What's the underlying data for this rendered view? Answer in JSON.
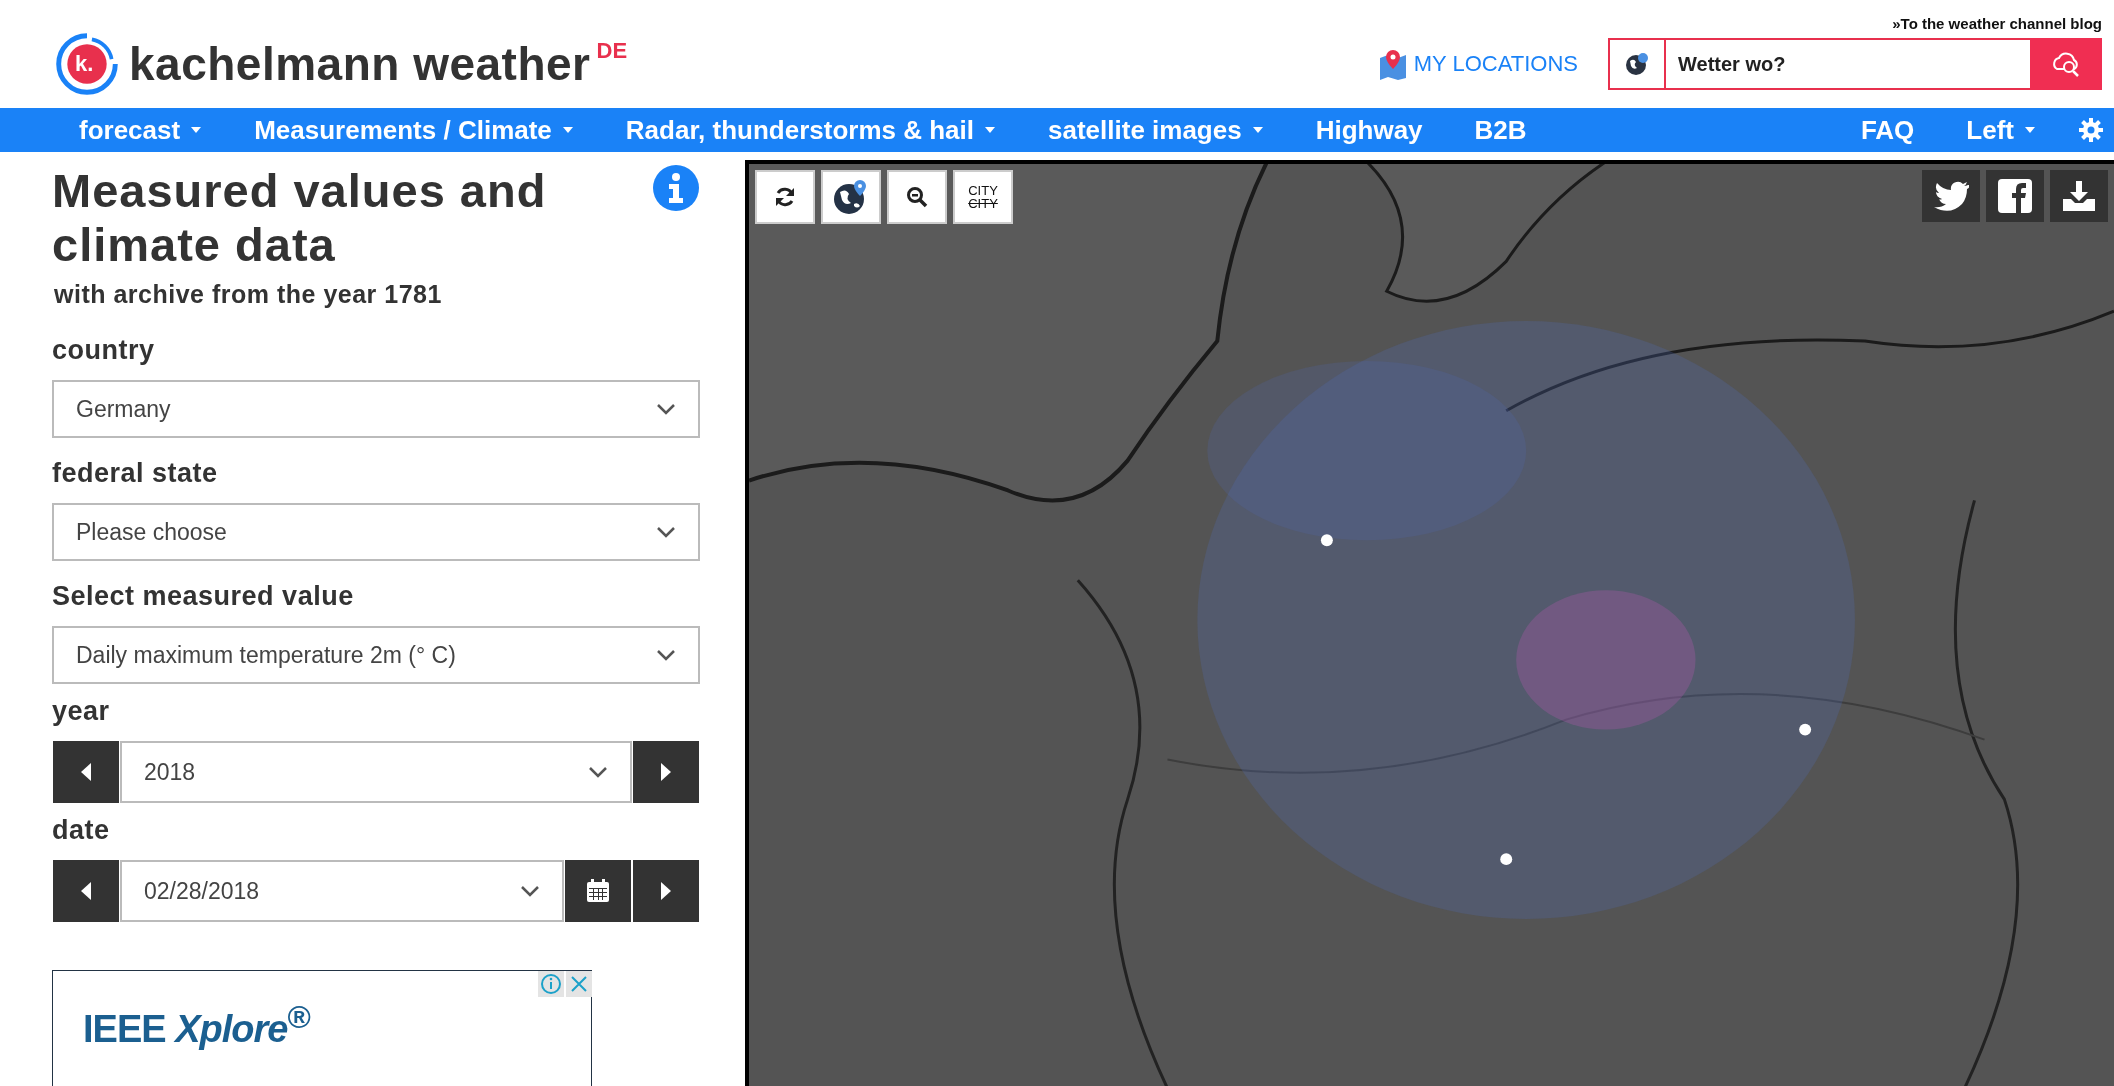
{
  "top_link": "»To the weather channel blog",
  "logo": {
    "mark": "k.",
    "name": "kachelmann weather",
    "sup": "DE"
  },
  "my_locations": "MY LOCATIONS",
  "search": {
    "placeholder": "Wetter wo?"
  },
  "nav": {
    "left": [
      {
        "label": "forecast",
        "caret": true
      },
      {
        "label": "Measurements / Climate",
        "caret": true
      },
      {
        "label": "Radar, thunderstorms & hail",
        "caret": true
      },
      {
        "label": "satellite images",
        "caret": true
      },
      {
        "label": "Highway",
        "caret": false
      },
      {
        "label": "B2B",
        "caret": false
      }
    ],
    "right": [
      {
        "label": "FAQ",
        "caret": false
      },
      {
        "label": "Left",
        "caret": true
      }
    ]
  },
  "panel": {
    "title": "Measured values and climate data",
    "subtitle": "with archive from the year 1781",
    "fields": [
      {
        "kind": "select",
        "label": "country",
        "value": "Germany"
      },
      {
        "kind": "select",
        "label": "federal state",
        "value": "Please choose"
      },
      {
        "kind": "select",
        "label": "Select measured value",
        "value": "Daily maximum temperature 2m (° C)"
      },
      {
        "kind": "stepper",
        "label": "year",
        "value": "2018"
      },
      {
        "kind": "date",
        "label": "date",
        "value": "02/28/2018"
      }
    ]
  },
  "ad": {
    "text": "IEEE *Xplore*$^{®}$"
  },
  "map": {
    "tools": [
      {
        "kind": "refresh"
      },
      {
        "kind": "locate"
      },
      {
        "kind": "zoom-out"
      },
      {
        "kind": "city",
        "label": "CITY",
        "struck": "CITY"
      }
    ],
    "share": [
      {
        "kind": "twitter"
      },
      {
        "kind": "facebook"
      },
      {
        "kind": "download"
      }
    ]
  }
}
